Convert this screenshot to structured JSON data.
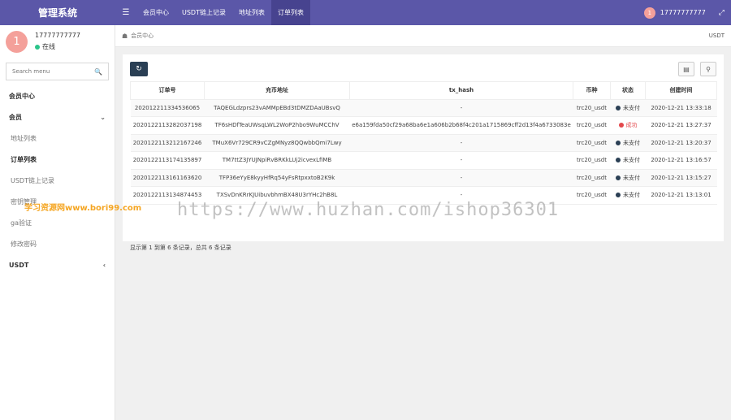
{
  "header": {
    "logo": "管理系统",
    "menu_icon": "bars-icon",
    "nav": [
      {
        "label": "会员中心"
      },
      {
        "label": "USDT链上记录"
      },
      {
        "label": "地址列表"
      },
      {
        "label": "订单列表"
      }
    ],
    "avatar_text": "1",
    "username": "17777777777",
    "fullscreen_icon": "expand-icon"
  },
  "sidebar": {
    "avatar_text": "1",
    "username": "17777777777",
    "status": "在线",
    "search_placeholder": "Search menu",
    "items": [
      {
        "label": "会员中心"
      },
      {
        "label": "会员"
      },
      {
        "label": "地址列表"
      },
      {
        "label": "订单列表"
      },
      {
        "label": "USDT链上记录"
      },
      {
        "label": "密钥管理"
      },
      {
        "label": "ga验证"
      },
      {
        "label": "修改密码"
      },
      {
        "label": "USDT"
      }
    ]
  },
  "breadcrumb": {
    "current": "会员中心",
    "right": "USDT"
  },
  "table": {
    "headers": [
      "订单号",
      "充币地址",
      "tx_hash",
      "币种",
      "状态",
      "创建时间"
    ],
    "rows": [
      [
        "2020122113345360​65",
        "TAQEGLdzprs23vAMMpEBd3tDMZDAaUBsvQ",
        "-",
        "trc20_usdt",
        "未支付",
        "2020-12-21 13:33:18"
      ],
      [
        "202012211328203719​8",
        "TF6sHDfTeaUWsqLWL2WoP2hbo9WuMCChV",
        "e6a159fda50cf29a68ba6e1a606b2b68f4c201a1715869cff2d13f4a6733083e",
        "trc20_usdt",
        "成功",
        "2020-12-21 13:27:37"
      ],
      [
        "20201221132121672​46",
        "TMuX6Vr729CR9vCZgMNyz8QQwbbQmi7Lwy",
        "-",
        "trc20_usdt",
        "未支付",
        "2020-12-21 13:20:37"
      ],
      [
        "20201221131741358​97",
        "TM7ttZ3JYUJNpiRvBRKkLUj2icvexLfiMB",
        "-",
        "trc20_usdt",
        "未支付",
        "2020-12-21 13:16:57"
      ],
      [
        "20201221131611636​20",
        "TFP36eYyE8kyyHfRq54yFsRtpxxtoB2K9k",
        "-",
        "trc20_usdt",
        "未支付",
        "2020-12-21 13:15:27"
      ],
      [
        "20201221131348744​53",
        "TXSvDnKRrKJUibuvbhmBX48U3rYHc2hB8L",
        "-",
        "trc20_usdt",
        "未支付",
        "2020-12-21 13:13:01"
      ]
    ]
  },
  "pager_text": "显示第 1 到第 6 条记录，总共 6 条记录",
  "watermark": "https://www.huzhan.com/ishop36301",
  "watermark_left": "学习资源网www.bori99.com",
  "colors": {
    "topbar": "#5b57a8",
    "topbar_active": "#47438f",
    "avatar": "#f4a09a",
    "online": "#2bc48a",
    "unpaid": "#2a3f54",
    "success": "#e3474b"
  }
}
